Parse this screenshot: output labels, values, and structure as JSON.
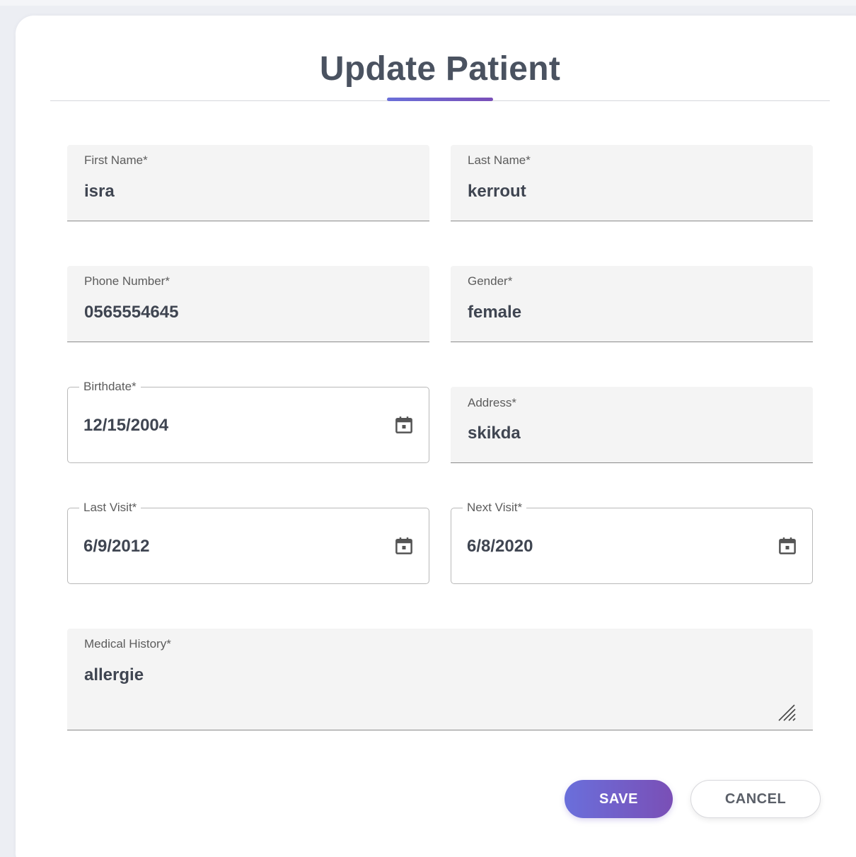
{
  "dialog": {
    "title": "Update Patient"
  },
  "fields": {
    "first_name": {
      "label": "First Name*",
      "value": "isra"
    },
    "last_name": {
      "label": "Last Name*",
      "value": "kerrout"
    },
    "phone_number": {
      "label": "Phone Number*",
      "value": "0565554645"
    },
    "gender": {
      "label": "Gender*",
      "value": "female"
    },
    "birthdate": {
      "label": "Birthdate*",
      "value": "12/15/2004",
      "icon": "calendar-icon"
    },
    "address": {
      "label": "Address*",
      "value": "skikda"
    },
    "last_visit": {
      "label": "Last Visit*",
      "value": "6/9/2012",
      "icon": "calendar-icon"
    },
    "next_visit": {
      "label": "Next Visit*",
      "value": "6/8/2020",
      "icon": "calendar-icon"
    },
    "medical_history": {
      "label": "Medical History*",
      "value": "allergie",
      "icon": "resize-handle-icon"
    }
  },
  "actions": {
    "save_label": "SAVE",
    "cancel_label": "CANCEL"
  },
  "colors": {
    "accent_start": "#6a6fdb",
    "accent_end": "#7a4fb6",
    "field_bg": "#f4f4f4",
    "text": "#3f4551"
  }
}
